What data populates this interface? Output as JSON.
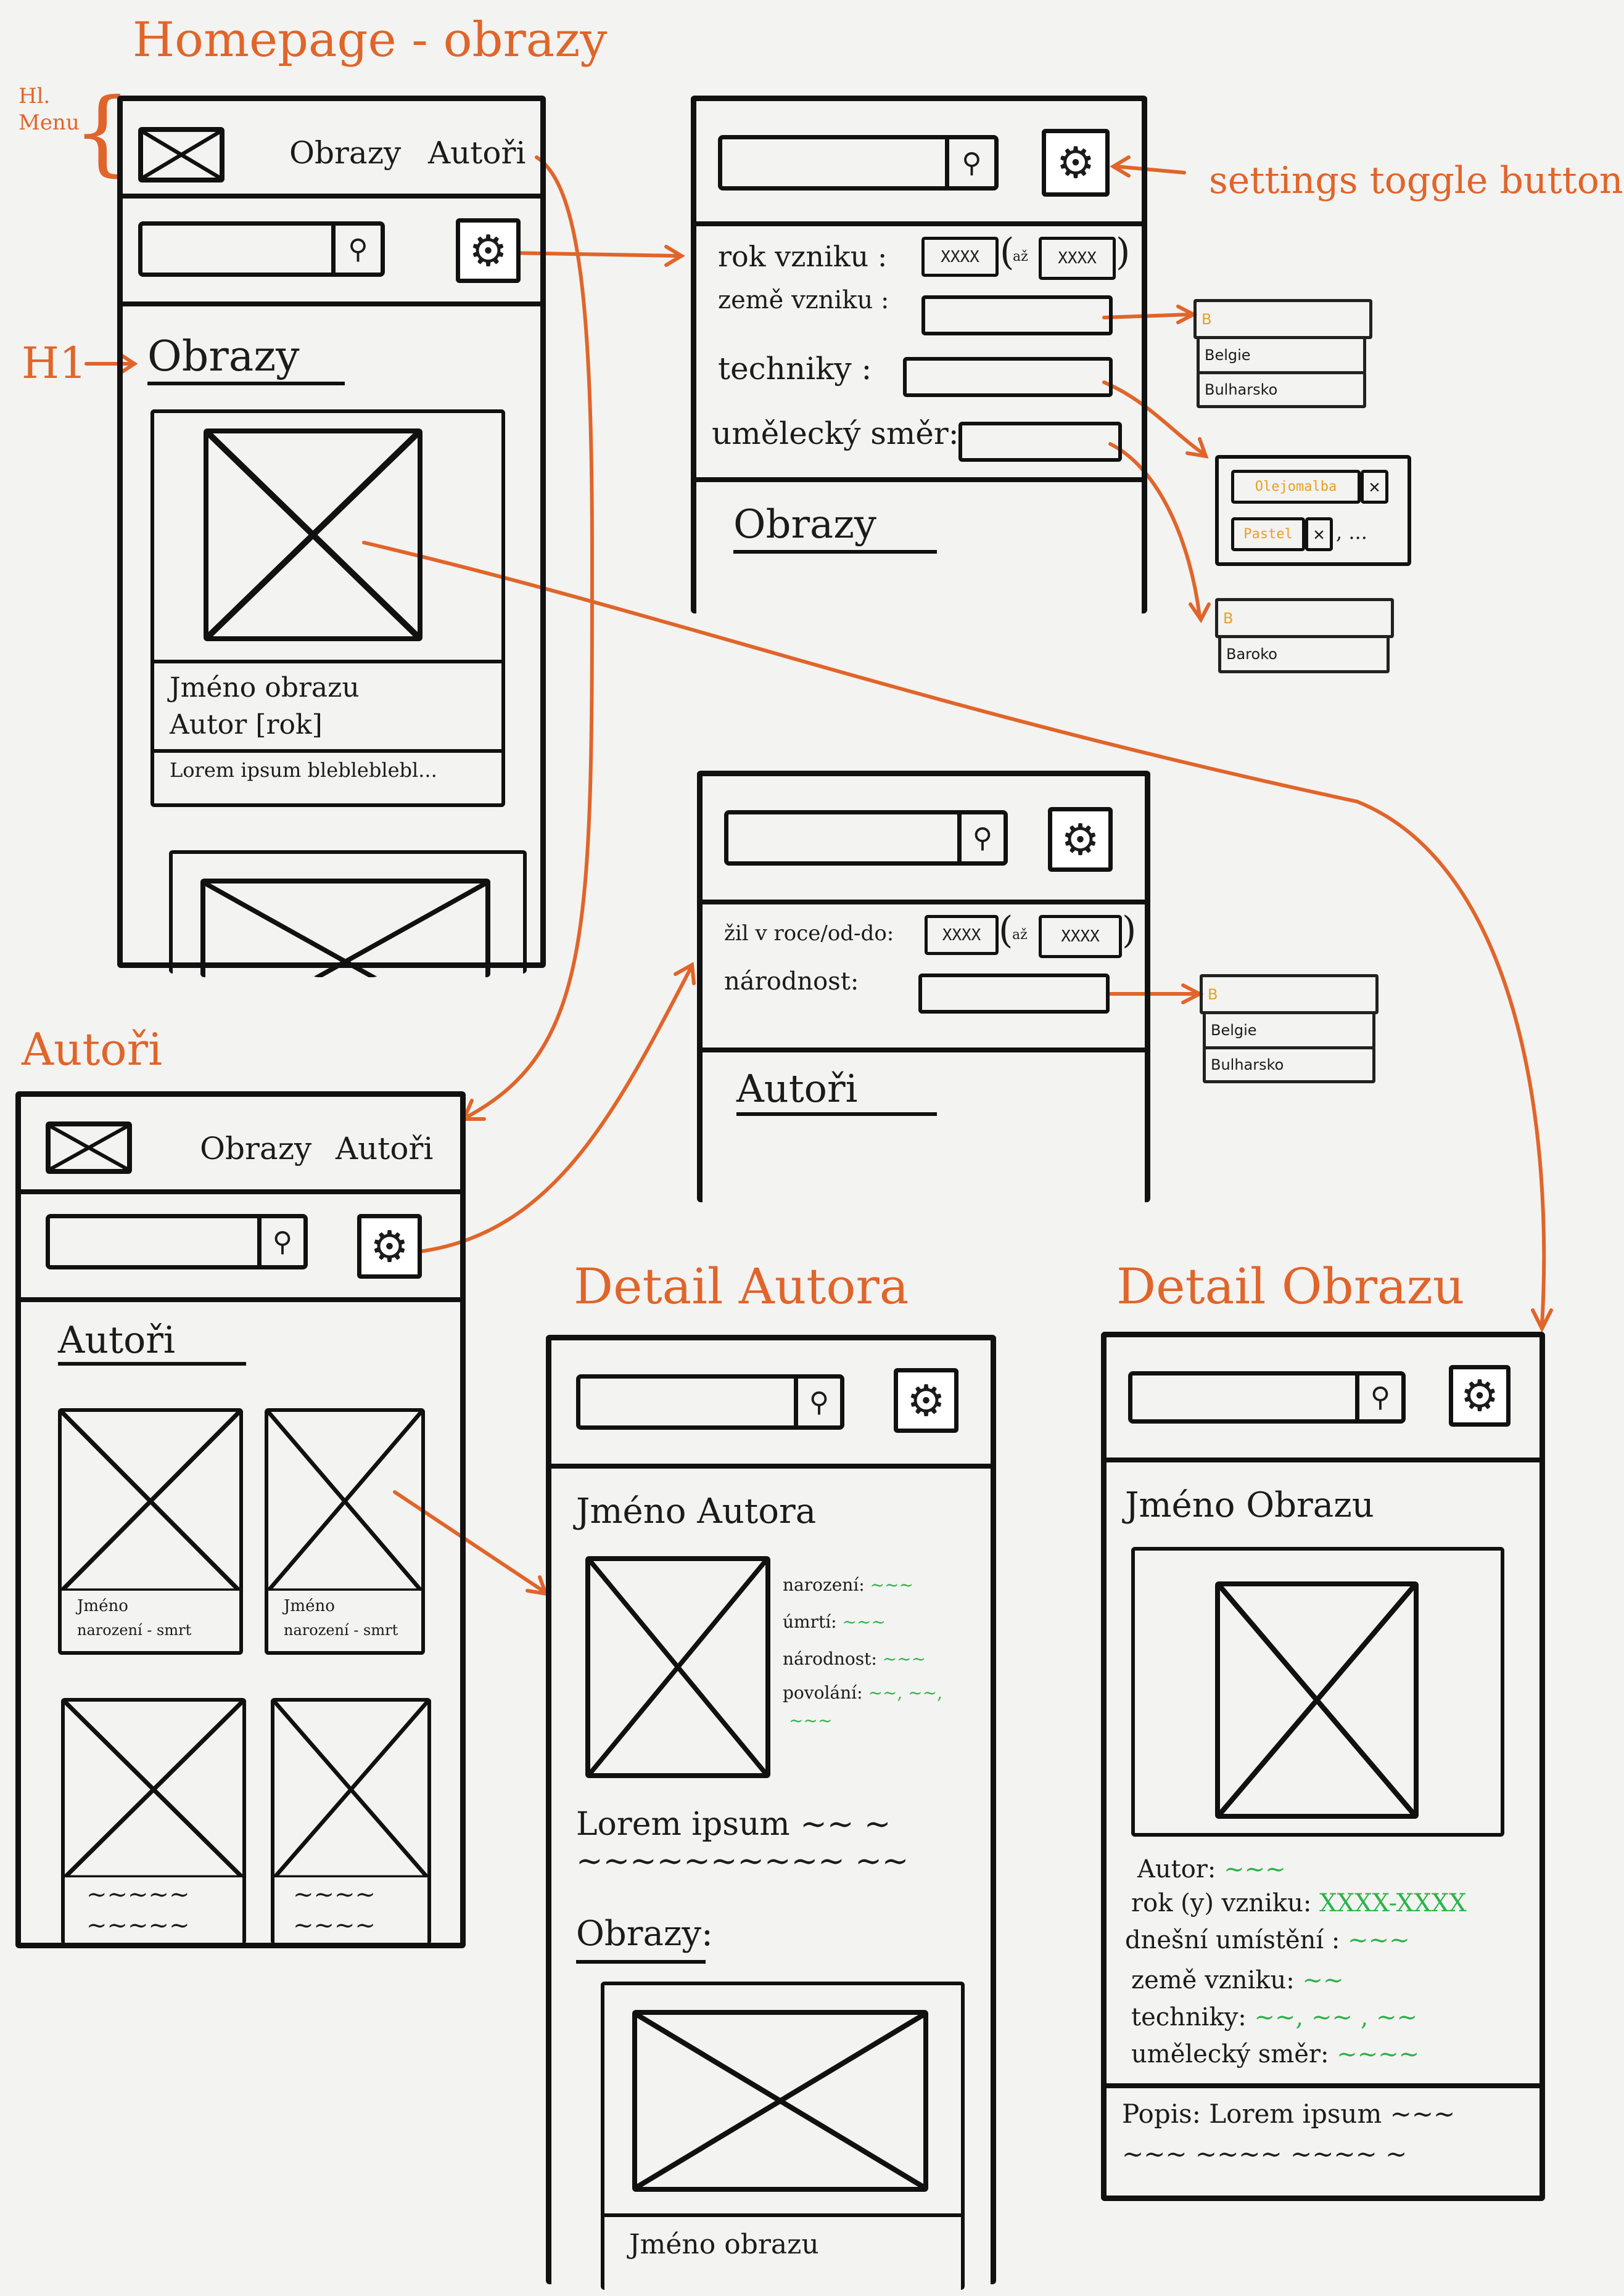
{
  "annotations": {
    "homepage_title": "Homepage - obrazy",
    "hl_menu": "Hl. Menu",
    "h1": "H1",
    "settings_toggle": "settings toggle button",
    "autori_title": "Autoři",
    "detail_autora_title": "Detail Autora",
    "detail_obrazu_title": "Detail Obrazu"
  },
  "menu": {
    "obrazy": "Obrazy",
    "autori": "Autoři"
  },
  "homepage": {
    "heading": "Obrazy",
    "card_title": "Jméno obrazu",
    "card_meta": "Autor [rok]",
    "card_desc": "Lorem ipsum blebleblebl..."
  },
  "filter_obrazy": {
    "rok_vzniku": "rok vzniku :",
    "od_value": "XXXX",
    "az_label": "až",
    "do_value": "XXXX",
    "zeme_vzniku": "země vzniku :",
    "techniky": "techniky :",
    "umelecky_smer": "umělecký směr:",
    "heading": "Obrazy"
  },
  "dropdown_countries": {
    "typed": "B",
    "options": [
      "Belgie",
      "Bulharsko"
    ]
  },
  "dropdown_techniques": {
    "chips": [
      "Olejomalba",
      "Pastel"
    ],
    "more": ", ..."
  },
  "dropdown_styles": {
    "typed": "B",
    "options": [
      "Baroko"
    ]
  },
  "filter_autori": {
    "zil_label": "žil v roce/od-do:",
    "od_value": "XXXX",
    "az_label": "až",
    "do_value": "XXXX",
    "narodnost": "národnost:",
    "heading": "Autoři"
  },
  "autori_page": {
    "heading": "Autoři",
    "card_name": "Jméno",
    "card_dates": "narození - smrt"
  },
  "detail_autora": {
    "name": "Jméno Autora",
    "narozeni": "narození:",
    "umrti": "úmrtí:",
    "narodnost": "národnost:",
    "povolani": "povolání:",
    "lorem": "Lorem ipsum",
    "obrazy_heading": "Obrazy:",
    "card_title": "Jméno obrazu"
  },
  "detail_obrazu": {
    "name": "Jméno Obrazu",
    "autor": "Autor:",
    "roky_vzniku": "rok (y) vzniku:",
    "roky_value": "XXXX-XXXX",
    "umisteni": "dnešní umístění :",
    "zeme": "země vzniku:",
    "techniky": "techniky:",
    "smer": "umělecký směr:",
    "popis": "Popis:",
    "popis_value": "Lorem ipsum"
  },
  "colors": {
    "annotation": "#e0652a",
    "filled_value": "#2db34a",
    "typed_letter": "#e8a020"
  }
}
